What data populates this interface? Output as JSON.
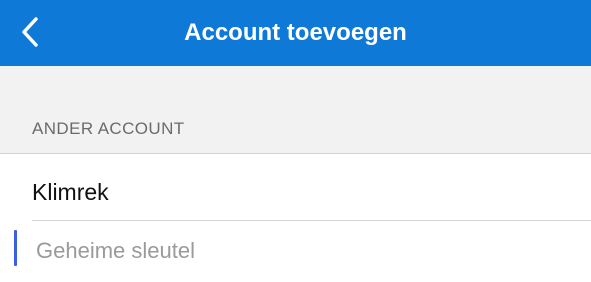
{
  "header": {
    "title": "Account toevoegen",
    "back_icon": "chevron-left-icon",
    "background_color": "#0f79d8",
    "title_color": "#ffffff"
  },
  "section": {
    "label": "ANDER ACCOUNT"
  },
  "form": {
    "name_value": "Klimrek",
    "secret_placeholder": "Geheime sleutel",
    "secret_value": "",
    "caret_color": "#3a5fe0"
  }
}
